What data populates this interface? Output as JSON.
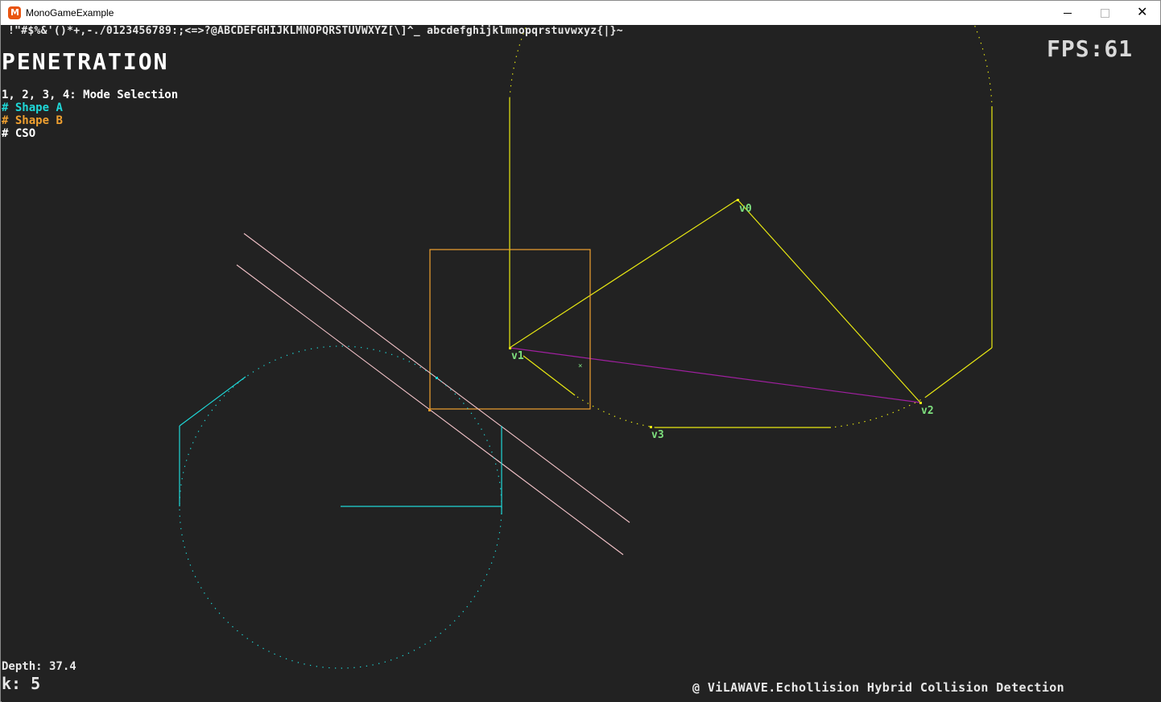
{
  "window": {
    "title": "MonoGameExample",
    "icon": "monogame-icon",
    "controls": {
      "minimize_icon": "minimize-icon",
      "maximize_icon": "maximize-icon",
      "close_icon": "close-icon",
      "close_glyph": "✕"
    }
  },
  "hud": {
    "charset": "!\"#$%&'()*+,-./0123456789:;<=>?@ABCDEFGHIJKLMNOPQRSTUVWXYZ[\\]^_ abcdefghijklmnopqrstuvwxyz{|}~",
    "mode_title": "PENETRATION",
    "fps": "FPS:61",
    "mode_help": "1, 2, 3, 4: Mode Selection",
    "legend": {
      "shape_a_marker": "#",
      "shape_a": "Shape A",
      "shape_b_marker": "#",
      "shape_b": "Shape B",
      "cso_marker": "#",
      "cso": "CSO"
    },
    "depth": "Depth: 37.4",
    "k": "k: 5",
    "credit": "@ ViLAWAVE.Echollision Hybrid Collision Detection"
  },
  "scene": {
    "vertex_labels": [
      "v0",
      "v1",
      "v2",
      "v3"
    ],
    "colors": {
      "background": "#222222",
      "shape_a": "#1fd7d7",
      "shape_b": "#f0a030",
      "cso": "#e8e812",
      "simplex_edge": "#a020a0",
      "normal_lines": "#f2c2c8",
      "vertex_label": "#7ee07e",
      "hud_text": "#ffffff"
    }
  }
}
